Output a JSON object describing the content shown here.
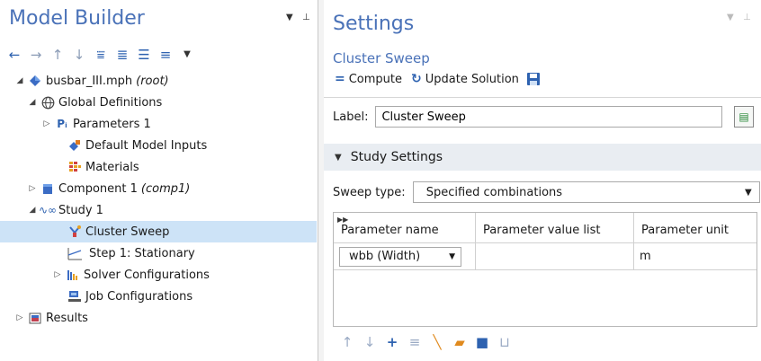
{
  "model_builder": {
    "title": "Model Builder",
    "toolbar_icons": [
      "arrow-left-icon",
      "arrow-right-icon",
      "arrow-up-icon",
      "arrow-down-icon",
      "filter-icon",
      "collapse-icon",
      "expand-icon",
      "list-icon",
      "dropdown-icon"
    ],
    "tree": [
      {
        "label": "busbar_III.mph",
        "tag": "(root)",
        "icon": "model-icon",
        "level": 0,
        "toggle": "expanded"
      },
      {
        "label": "Global Definitions",
        "tag": "",
        "icon": "globe-icon",
        "level": 1,
        "toggle": "expanded"
      },
      {
        "label": "Parameters 1",
        "tag": "",
        "icon": "parameters-icon",
        "level": 2,
        "toggle": "collapsed"
      },
      {
        "label": "Default Model Inputs",
        "tag": "",
        "icon": "model-inputs-icon",
        "level": 2,
        "toggle": "none"
      },
      {
        "label": "Materials",
        "tag": "",
        "icon": "materials-icon",
        "level": 2,
        "toggle": "none"
      },
      {
        "label": "Component 1",
        "tag": "(comp1)",
        "icon": "component-icon",
        "level": 1,
        "toggle": "collapsed"
      },
      {
        "label": "Study 1",
        "tag": "",
        "icon": "study-icon",
        "level": 1,
        "toggle": "expanded"
      },
      {
        "label": "Cluster Sweep",
        "tag": "",
        "icon": "cluster-sweep-icon",
        "level": 2,
        "toggle": "none",
        "selected": true
      },
      {
        "label": "Step 1: Stationary",
        "tag": "",
        "icon": "stationary-step-icon",
        "level": 2,
        "toggle": "none"
      },
      {
        "label": "Solver Configurations",
        "tag": "",
        "icon": "solver-icon",
        "level": 2,
        "toggle": "collapsed"
      },
      {
        "label": "Job Configurations",
        "tag": "",
        "icon": "job-icon",
        "level": 2,
        "toggle": "none"
      },
      {
        "label": "Results",
        "tag": "",
        "icon": "results-icon",
        "level": 1,
        "toggle": "collapsed"
      }
    ]
  },
  "settings": {
    "title": "Settings",
    "subtitle": "Cluster Sweep",
    "toolbar": {
      "compute_label": "Compute",
      "update_label": "Update Solution"
    },
    "label_caption": "Label:",
    "label_value": "Cluster Sweep",
    "study_settings_header": "Study Settings",
    "sweep_type_caption": "Sweep type:",
    "sweep_type_value": "Specified combinations",
    "table": {
      "columns": [
        "Parameter name",
        "Parameter value list",
        "Parameter unit"
      ],
      "rows": [
        {
          "name": "wbb (Width)",
          "values": "",
          "unit": "m"
        }
      ]
    },
    "table_toolbar_icons": [
      "move-up-icon",
      "move-down-icon",
      "add-icon",
      "delete-icon",
      "clear-icon",
      "load-icon",
      "save-icon",
      "range-icon"
    ]
  }
}
